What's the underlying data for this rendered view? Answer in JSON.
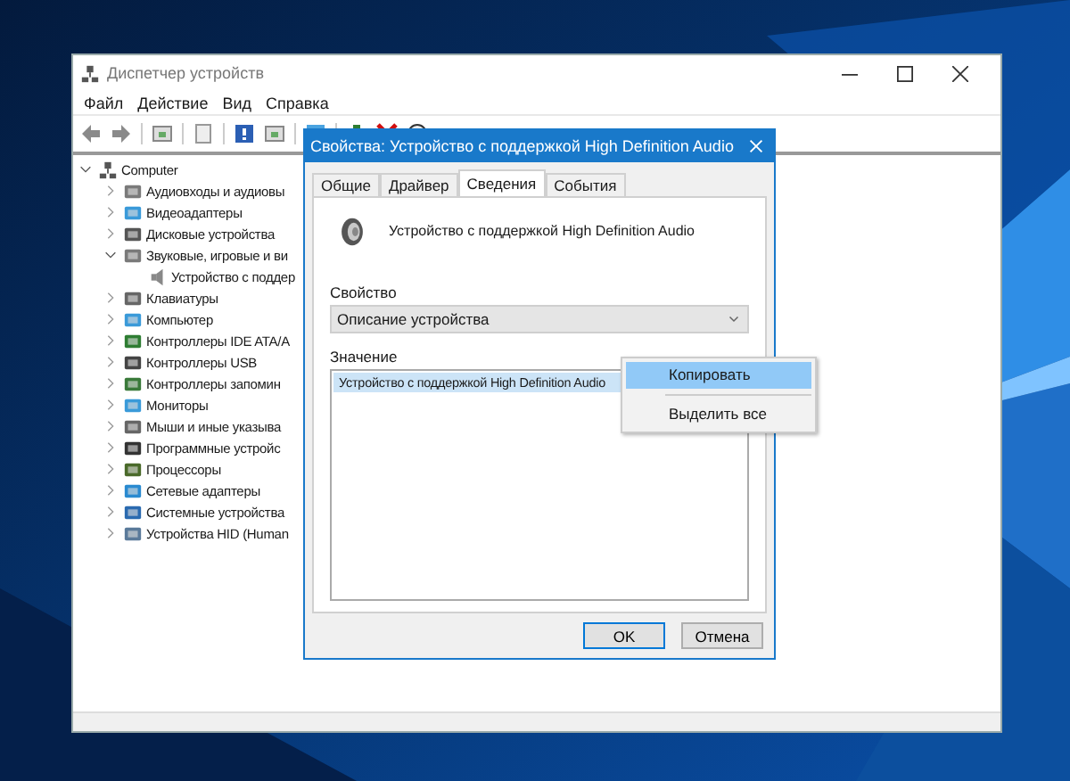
{
  "main_window": {
    "title": "Диспетчер устройств",
    "menu": [
      "Файл",
      "Действие",
      "Вид",
      "Справка"
    ],
    "tree": [
      {
        "label": "Computer",
        "expanded": true,
        "children": [
          {
            "label": "Аудиовходы и аудиовы",
            "expanded": false
          },
          {
            "label": "Видеоадаптеры",
            "expanded": false
          },
          {
            "label": "Дисковые устройства",
            "expanded": false
          },
          {
            "label": "Звуковые, игровые и ви",
            "expanded": true,
            "children": [
              {
                "label": "Устройство с поддер"
              }
            ]
          },
          {
            "label": "Клавиатуры",
            "expanded": false
          },
          {
            "label": "Компьютер",
            "expanded": false
          },
          {
            "label": "Контроллеры IDE ATA/A",
            "expanded": false
          },
          {
            "label": "Контроллеры USB",
            "expanded": false
          },
          {
            "label": "Контроллеры запомин",
            "expanded": false
          },
          {
            "label": "Мониторы",
            "expanded": false
          },
          {
            "label": "Мыши и иные указыва",
            "expanded": false
          },
          {
            "label": "Программные устройс",
            "expanded": false
          },
          {
            "label": "Процессоры",
            "expanded": false
          },
          {
            "label": "Сетевые адаптеры",
            "expanded": false
          },
          {
            "label": "Системные устройства",
            "expanded": false
          },
          {
            "label": "Устройства HID (Human",
            "expanded": false
          }
        ]
      }
    ]
  },
  "dialog": {
    "title": "Свойства: Устройство с поддержкой High Definition Audio",
    "tabs": [
      {
        "label": "Общие",
        "selected": false
      },
      {
        "label": "Драйвер",
        "selected": false
      },
      {
        "label": "Сведения",
        "selected": true
      },
      {
        "label": "События",
        "selected": false
      }
    ],
    "device_name": "Устройство с поддержкой High Definition Audio",
    "property_label": "Свойство",
    "property_value": "Описание устройства",
    "value_label": "Значение",
    "values": [
      {
        "text": "Устройство с поддержкой High Definition Audio",
        "selected": true
      }
    ],
    "buttons": [
      {
        "label": "OK",
        "default": true
      },
      {
        "label": "Отмена",
        "default": false
      }
    ]
  },
  "context_menu": {
    "items": [
      {
        "label": "Копировать",
        "highlighted": true
      },
      {
        "label": "Выделить все",
        "highlighted": false
      }
    ]
  }
}
